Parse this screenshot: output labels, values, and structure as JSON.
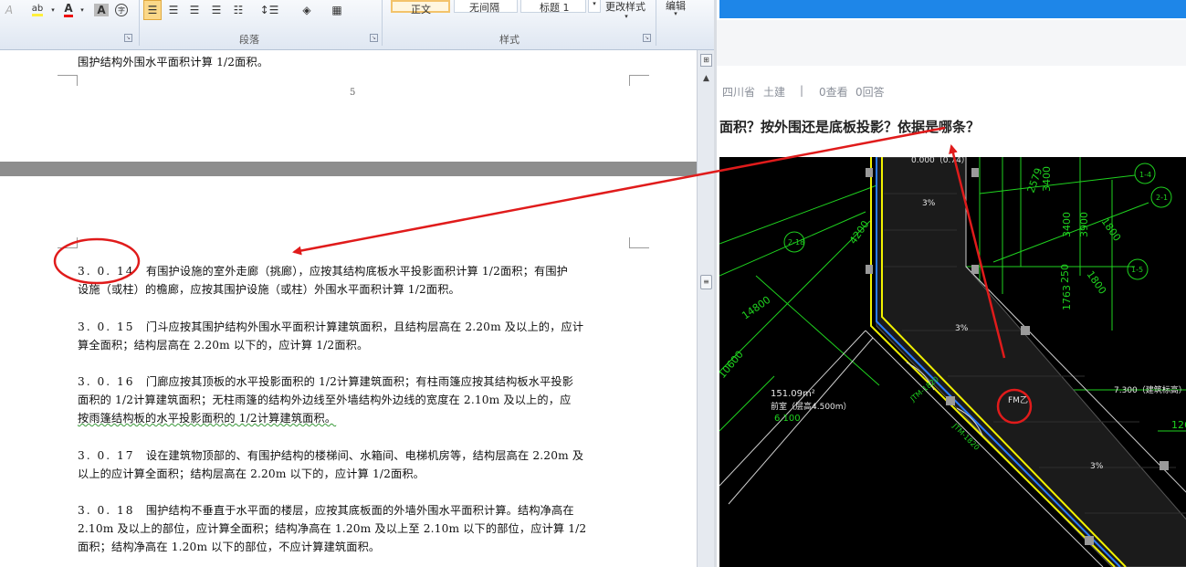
{
  "ribbon": {
    "paragraph_group_label": "段落",
    "styles_group_label": "样式",
    "style_normal": "正文",
    "style_no_spacing": "无间隔",
    "style_heading1": "标题 1",
    "change_styles": "更改样式",
    "edit": "编辑"
  },
  "document": {
    "prev_page_line": "围护结构外围水平面积计算 1/2面积。",
    "page_number": "5",
    "paragraphs": [
      {
        "num": "3. 0. 14",
        "lines": [
          "有围护设施的室外走廊（挑廊），应按其结构底板水平投影面积计算 1/2面积；有围护",
          "设施（或柱）的檐廊，应按其围护设施（或柱）外围水平面积计算 1/2面积。"
        ]
      },
      {
        "num": "3. 0. 15",
        "lines": [
          "门斗应按其围护结构外围水平面积计算建筑面积，且结构层高在 2.20m 及以上的，应计",
          "算全面积；结构层高在 2.20m 以下的，应计算 1/2面积。"
        ]
      },
      {
        "num": "3. 0. 16",
        "lines": [
          "门廊应按其顶板的水平投影面积的 1/2计算建筑面积；有柱雨篷应按其结构板水平投影",
          "面积的 1/2计算建筑面积；无柱雨篷的结构外边线至外墙结构外边线的宽度在 2.10m 及以上的，应",
          "按雨篷结构板的水平投影面积的 1/2计算建筑面积。"
        ]
      },
      {
        "num": "3. 0. 17",
        "lines": [
          "设在建筑物顶部的、有围护结构的楼梯间、水箱间、电梯机房等，结构层高在 2.20m 及",
          "以上的应计算全面积；结构层高在 2.20m 以下的，应计算 1/2面积。"
        ]
      },
      {
        "num": "3. 0. 18",
        "lines": [
          "围护结构不垂直于水平面的楼层，应按其底板面的外墙外围水平面积计算。结构净高在",
          "2.10m 及以上的部位，应计算全面积；结构净高在 1.20m 及以上至 2.10m 以下的部位，应计算 1/2",
          "面积；结构净高在 1.20m 以下的部位，不应计算建筑面积。"
        ]
      }
    ]
  },
  "web": {
    "province": "四川省",
    "category": "土建",
    "separator": "|",
    "views": "0查看",
    "answers": "0回答",
    "question_title": "面积？按外围还是底板投影？依据是哪条？"
  },
  "cad": {
    "dims": [
      "3400",
      "3900",
      "1800",
      "2579",
      "250",
      "1763",
      "1800",
      "4200",
      "14800",
      "10600"
    ],
    "axes": [
      "1-4",
      "2-1",
      "1-5",
      "2-18"
    ],
    "room_line1": "151.09m²",
    "room_line2": "前室（层高4.500m）",
    "level_left": "6.100",
    "level_right": "7.300（建筑标高）",
    "fm_label": "FM乙",
    "slope": "3%",
    "cut_text": "126",
    "top_dim": "0.000（0.74）",
    "ramp_label": "JTM-1820"
  },
  "colors": {
    "annotation": "#e01b1b",
    "cad_bg": "#000000",
    "cad_green": "#1fd21f",
    "cad_yellow": "#f2f200",
    "web_blue": "#1e86e8"
  }
}
